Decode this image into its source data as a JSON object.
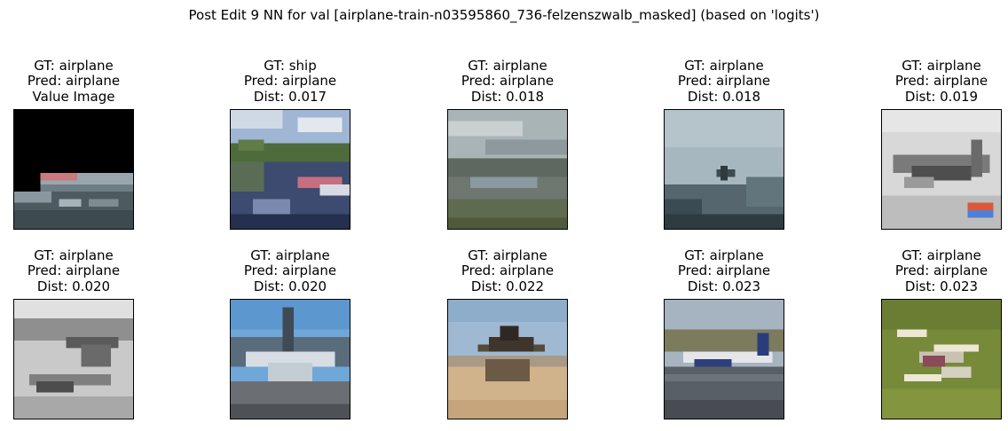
{
  "figure": {
    "title": "Post Edit 9 NN for val [airplane-train-n03595860_736-felzenszwalb_masked] (based on 'logits')"
  },
  "panels": [
    {
      "gt": "GT: airplane",
      "pred": "Pred: airplane",
      "extra": "Value Image",
      "thumbnail": "masked-airplane-on-tarmac"
    },
    {
      "gt": "GT: ship",
      "pred": "Pred: airplane",
      "extra": "Dist: 0.017",
      "thumbnail": "river-with-boats"
    },
    {
      "gt": "GT: airplane",
      "pred": "Pred: airplane",
      "extra": "Dist: 0.018",
      "thumbnail": "airfield-cloudy-sky"
    },
    {
      "gt": "GT: airplane",
      "pred": "Pred: airplane",
      "extra": "Dist: 0.018",
      "thumbnail": "plane-in-grey-sky"
    },
    {
      "gt": "GT: airplane",
      "pred": "Pred: airplane",
      "extra": "Dist: 0.019",
      "thumbnail": "grayscale-fighter-plane"
    },
    {
      "gt": "GT: airplane",
      "pred": "Pred: airplane",
      "extra": "Dist: 0.020",
      "thumbnail": "grayscale-biplanes"
    },
    {
      "gt": "GT: airplane",
      "pred": "Pred: airplane",
      "extra": "Dist: 0.020",
      "thumbnail": "planes-at-airport"
    },
    {
      "gt": "GT: airplane",
      "pred": "Pred: airplane",
      "extra": "Dist: 0.022",
      "thumbnail": "stealth-plane-on-sand"
    },
    {
      "gt": "GT: airplane",
      "pred": "Pred: airplane",
      "extra": "Dist: 0.023",
      "thumbnail": "airliner-on-runway"
    },
    {
      "gt": "GT: airplane",
      "pred": "Pred: airplane",
      "extra": "Dist: 0.023",
      "thumbnail": "model-plane-on-grass"
    }
  ]
}
